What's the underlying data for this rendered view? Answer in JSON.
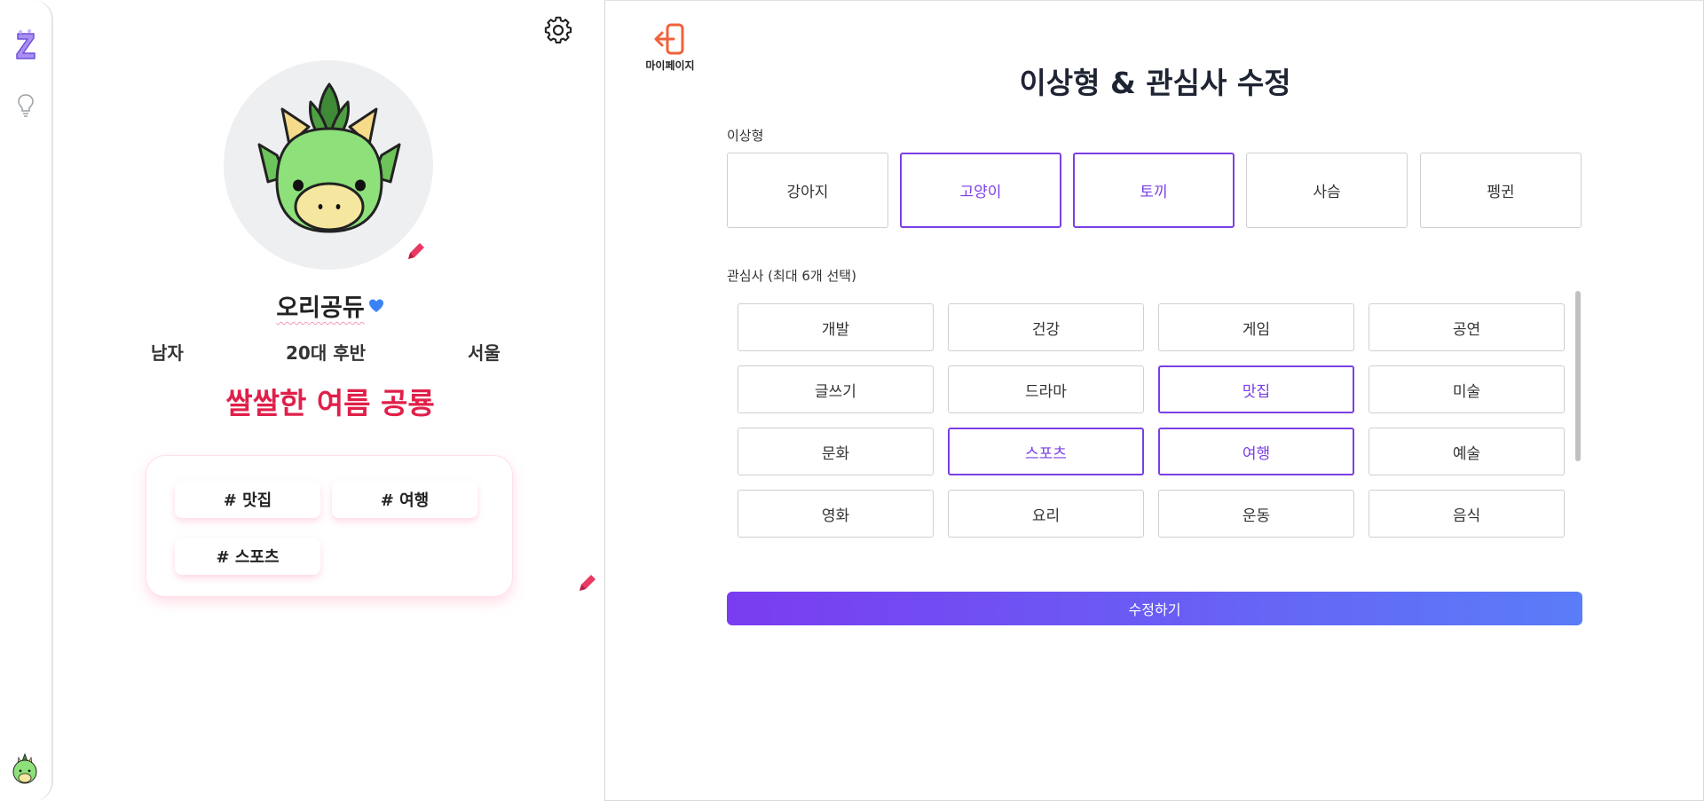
{
  "rail": {
    "logo": "z-logo",
    "hint_icon": "lightbulb-icon",
    "avatar_icon": "dragon-avatar-icon"
  },
  "profile": {
    "settings_icon": "gear-icon",
    "avatar_icon": "dragon-avatar-icon",
    "edit_icon": "pencil-icon",
    "nickname": "오리공듀",
    "badge_icon": "heart-icon",
    "gender": "남자",
    "age": "20대 후반",
    "region": "서울",
    "motto": "쌀쌀한 여름 공룡",
    "tags": [
      "# 맛집",
      "# 여행",
      "# 스포츠"
    ]
  },
  "edit": {
    "back_label": "마이페이지",
    "back_icon": "exit-icon",
    "title": "이상형 & 관심사 수정",
    "ideal_label": "이상형",
    "ideal_options": [
      {
        "label": "강아지",
        "selected": false
      },
      {
        "label": "고양이",
        "selected": true
      },
      {
        "label": "토끼",
        "selected": true
      },
      {
        "label": "사슴",
        "selected": false
      },
      {
        "label": "펭귄",
        "selected": false
      }
    ],
    "interest_label": "관심사 (최대 6개 선택)",
    "interests": [
      {
        "label": "개발",
        "selected": false
      },
      {
        "label": "건강",
        "selected": false
      },
      {
        "label": "게임",
        "selected": false
      },
      {
        "label": "공연",
        "selected": false
      },
      {
        "label": "글쓰기",
        "selected": false
      },
      {
        "label": "드라마",
        "selected": false
      },
      {
        "label": "맛집",
        "selected": true
      },
      {
        "label": "미술",
        "selected": false
      },
      {
        "label": "문화",
        "selected": false
      },
      {
        "label": "스포츠",
        "selected": true
      },
      {
        "label": "여행",
        "selected": true
      },
      {
        "label": "예술",
        "selected": false
      },
      {
        "label": "영화",
        "selected": false
      },
      {
        "label": "요리",
        "selected": false
      },
      {
        "label": "운동",
        "selected": false
      },
      {
        "label": "음식",
        "selected": false
      }
    ],
    "submit_label": "수정하기"
  },
  "colors": {
    "accent": "#7b3fe4",
    "motto": "#e0204a",
    "pencil": "#e83a62",
    "back_icon": "#f0623a",
    "heart": "#3b82f6",
    "submit_gradient_start": "#7a3cf0",
    "submit_gradient_end": "#5a7df8"
  }
}
